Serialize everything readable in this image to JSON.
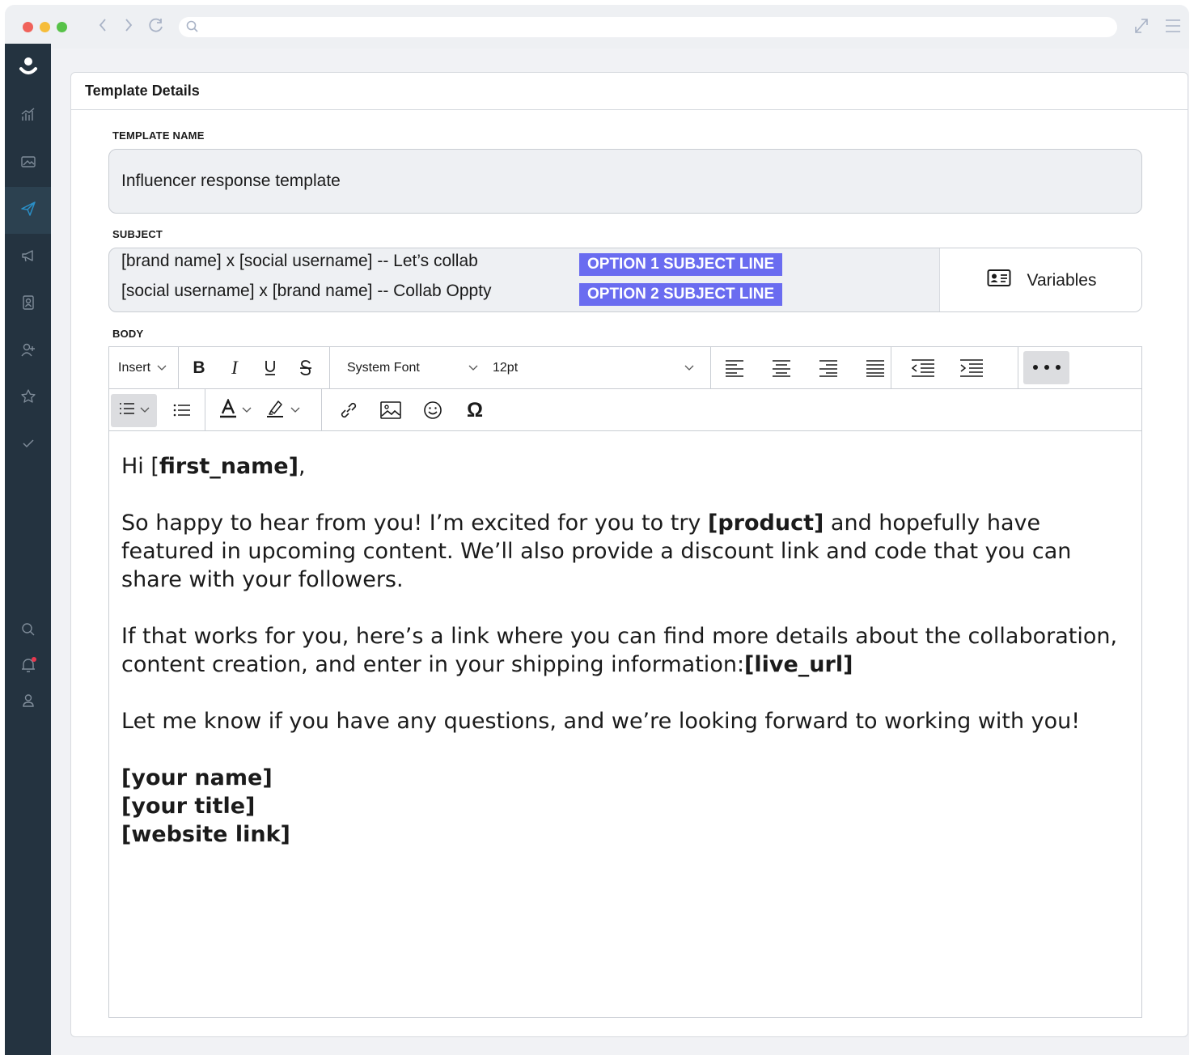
{
  "browser": {
    "url": ""
  },
  "panel": {
    "title": "Template Details"
  },
  "template_name": {
    "label": "TEMPLATE NAME",
    "value": "Influencer response template"
  },
  "subject": {
    "label": "SUBJECT",
    "lines": [
      {
        "text": "[brand name]  x [social username] -- Let’s collab",
        "tag": "OPTION 1 SUBJECT LINE"
      },
      {
        "text": "[social username]  x [brand name] -- Collab Oppty",
        "tag": "OPTION 2 SUBJECT LINE"
      }
    ],
    "variables_label": "Variables",
    "tag_color": "#6a6cf0"
  },
  "body": {
    "label": "BODY",
    "toolbar": {
      "insert_label": "Insert",
      "font_family": "System Font",
      "font_size": "12pt"
    },
    "greeting_prefix": "Hi [",
    "greeting_var": "first_name]",
    "greeting_suffix": ",",
    "p1_before": "So happy to hear from you! I’m excited for you to try ",
    "p1_var": "[product]",
    "p1_after": " and hopefully have featured in upcoming content. We’ll also provide a discount link and code that you can share with your followers.",
    "p2_before": "If that works for you, here’s a link where you can find more details about the collaboration, content creation, and enter in your shipping information:",
    "p2_var": "[live_url]",
    "p3": "Let me know if you have any questions, and we’re looking forward to working with you!",
    "sig_name": "[your name]",
    "sig_title": "[your title]",
    "sig_link": "[website link]"
  },
  "sidebar": {
    "items": [
      "logo",
      "analytics-icon",
      "media-icon",
      "send-icon",
      "megaphone-icon",
      "contacts-icon",
      "add-user-icon",
      "star-icon",
      "check-icon",
      "search-icon",
      "bell-icon",
      "user-icon"
    ],
    "active": "send-icon",
    "accent": "#2a8fc7"
  }
}
